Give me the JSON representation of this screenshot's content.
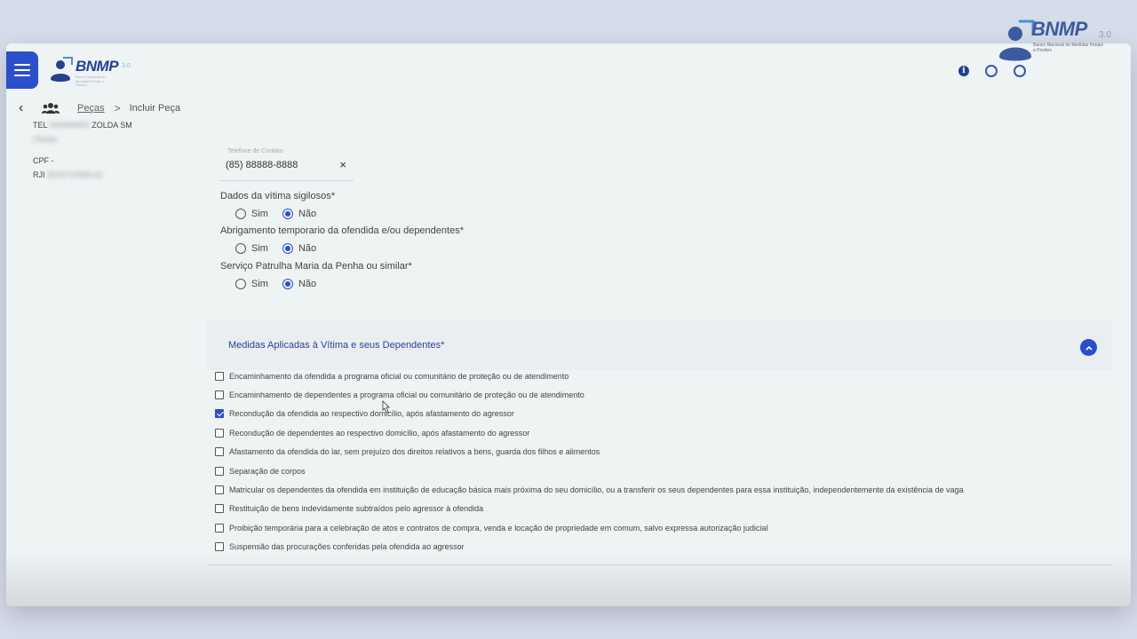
{
  "colors": {
    "accent": "#2b4ec9",
    "brand_text": "#24408f",
    "section_title": "#2b3f9c",
    "page_bg": "#eef3f4"
  },
  "header": {
    "logo": {
      "word": "BNMP",
      "version": "3.0",
      "subtitle": "Banco Nacional de Medidas Penais e Prisões"
    },
    "icons": [
      "menu-icon",
      "info-icon",
      "help-icon",
      "user-icon"
    ]
  },
  "overlay_logo": {
    "word": "BNMP",
    "version": "3.0",
    "subtitle": "Banco Nacional de Medidas Penais e Prisões"
  },
  "breadcrumb": {
    "link": "Peças",
    "separator": ">",
    "current": "Incluir Peça"
  },
  "left_info": {
    "line1_prefix": "TEL",
    "line1_suffix": "ZOLDA SM",
    "line2": "(Tesla)",
    "cpf_label": "CPF -",
    "rji_label": "RJI",
    "rji_value": "3234710060-01"
  },
  "phone": {
    "label": "Telefone de Contato",
    "value": "(85) 88888-8888",
    "clear": "×"
  },
  "questions": [
    {
      "label": "Dados da vítima sigilosos*",
      "options": [
        "Sim",
        "Não"
      ],
      "selected": "Não"
    },
    {
      "label": "Abrigamento temporario da ofendida e/ou dependentes*",
      "options": [
        "Sim",
        "Não"
      ],
      "selected": "Não"
    },
    {
      "label": "Serviço Patrulha Maria da Penha ou similar*",
      "options": [
        "Sim",
        "Não"
      ],
      "selected": "Não"
    }
  ],
  "medidas": {
    "title": "Medidas Aplicadas à Vítima e seus Dependentes*",
    "items": [
      {
        "label": "Encaminhamento da ofendida a programa oficial ou comunitário de proteção ou de atendimento",
        "checked": false
      },
      {
        "label": "Encaminhamento de dependentes a programa oficial ou comunitário de proteção ou de atendimento",
        "checked": false
      },
      {
        "label": "Recondução da ofendida ao respectivo domicílio, após afastamento do agressor",
        "checked": true
      },
      {
        "label": "Recondução de dependentes ao respectivo domicílio, após afastamento do agressor",
        "checked": false
      },
      {
        "label": "Afastamento da ofendida do lar, sem prejuízo dos direitos relativos a bens, guarda dos filhos e alimentos",
        "checked": false
      },
      {
        "label": "Separação de corpos",
        "checked": false
      },
      {
        "label": "Matricular os dependentes da ofendida em instituição de educação básica mais próxima do seu domicílio, ou a transferir os seus dependentes para essa instituição, independentemente da existência de vaga",
        "checked": false
      },
      {
        "label": "Restituição de bens indevidamente subtraídos pelo agressor à ofendida",
        "checked": false
      },
      {
        "label": "Proibição temporária para a celebração de atos e contratos de compra, venda e locação de propriedade em comum, salvo expressa autorização judicial",
        "checked": false
      },
      {
        "label": "Suspensão das procurações conferidas pela ofendida ao agressor",
        "checked": false
      }
    ]
  }
}
